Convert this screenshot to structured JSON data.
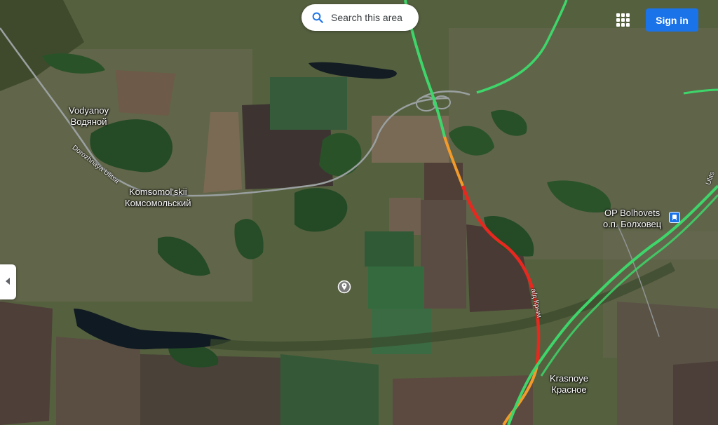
{
  "search_area": {
    "label": "Search this area",
    "icon": "search-icon"
  },
  "header": {
    "sign_in_label": "Sign in",
    "apps_icon": "apps-grid-icon"
  },
  "side_panel": {
    "toggle_icon": "chevron-left-icon"
  },
  "places": {
    "vodyanoy": {
      "latin": "Vodyanoy",
      "cyrillic": "Водяной"
    },
    "komsomolskii": {
      "latin": "Komsomol'skii",
      "cyrillic": "Комсомольский"
    },
    "op_bolhovets": {
      "latin": "OP Bolhovets",
      "cyrillic": "о.п. Болховец"
    },
    "krasnoye": {
      "latin": "Krasnoye",
      "cyrillic": "Красное"
    }
  },
  "streets": {
    "dorozhnaya": "Dorozhnaya Ulitsa",
    "highway": "а/д Крым",
    "edge": "Ulits"
  },
  "colors": {
    "traffic_green": "#3ed66a",
    "traffic_orange": "#f29b2b",
    "traffic_red": "#e8281f",
    "button_blue": "#1a73e8"
  }
}
